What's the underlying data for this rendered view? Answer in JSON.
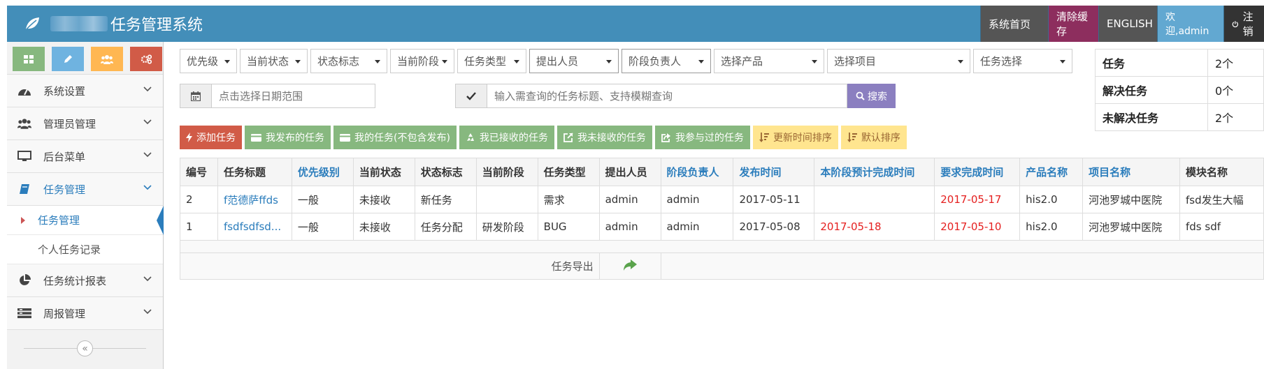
{
  "header": {
    "title": "任务管理系统",
    "nav": [
      "系统首页",
      "清除缓存",
      "ENGLISH",
      "欢迎,admin",
      "注销"
    ],
    "nav_colors": [
      "#555555",
      "#8d2e5e",
      "#555555",
      "#62a8d1",
      "#333333"
    ]
  },
  "sidebar": {
    "shortcut_colors": [
      "#87b87f",
      "#6fb3e0",
      "#ffb752",
      "#d15b47"
    ],
    "shortcut_icons": [
      "grid-icon",
      "pencil-icon",
      "users-icon",
      "cogs-icon"
    ],
    "menu": [
      {
        "label": "系统设置",
        "icon": "dashboard-icon"
      },
      {
        "label": "管理员管理",
        "icon": "users-icon"
      },
      {
        "label": "后台菜单",
        "icon": "monitor-icon"
      },
      {
        "label": "任务管理",
        "icon": "book-icon"
      }
    ],
    "submenu": [
      {
        "label": "任务管理"
      },
      {
        "label": "个人任务记录"
      }
    ],
    "menu2": [
      {
        "label": "任务统计报表",
        "icon": "pie-chart-icon"
      },
      {
        "label": "周报管理",
        "icon": "list-icon"
      }
    ],
    "collapse_glyph": "«"
  },
  "filters": {
    "selects": [
      "优先级",
      "当前状态",
      "状态标志",
      "当前阶段",
      "任务类型",
      "提出人员",
      "阶段负责人",
      "选择产品",
      "选择项目",
      "任务选择"
    ],
    "date_placeholder": "点击选择日期范围",
    "search_placeholder": "输入需查询的任务标题、支持模糊查询",
    "search_label": "搜索"
  },
  "stats": [
    {
      "label": "任务",
      "value": "2个"
    },
    {
      "label": "解决任务",
      "value": "0个"
    },
    {
      "label": "未解决任务",
      "value": "2个"
    }
  ],
  "actions": [
    {
      "label": "添加任务",
      "style": "red"
    },
    {
      "label": "我发布的任务",
      "style": "green"
    },
    {
      "label": "我的任务(不包含发布)",
      "style": "green"
    },
    {
      "label": "我已接收的任务",
      "style": "green"
    },
    {
      "label": "我未接收的任务",
      "style": "green"
    },
    {
      "label": "我参与过的任务",
      "style": "green"
    },
    {
      "label": "更新时间排序",
      "style": "yellow"
    },
    {
      "label": "默认排序",
      "style": "yellow"
    }
  ],
  "table": {
    "columns": [
      "编号",
      "任务标题",
      "优先级别",
      "当前状态",
      "状态标志",
      "当前阶段",
      "任务类型",
      "提出人员",
      "阶段负责人",
      "发布时间",
      "本阶段预计完成时间",
      "要求完成时间",
      "产品名称",
      "项目名称",
      "模块名称"
    ],
    "rows": [
      [
        "2",
        "f范德萨ffds",
        "一般",
        "未接收",
        "新任务",
        "",
        "需求",
        "admin",
        "admin",
        "2017-05-11",
        "",
        "2017-05-17",
        "his2.0",
        "河池罗城中医院",
        "fsd发生大幅"
      ],
      [
        "1",
        "fsdfsdfsd...",
        "一般",
        "未接收",
        "任务分配",
        "研发阶段",
        "BUG",
        "admin",
        "admin",
        "2017-05-08",
        "2017-05-18",
        "2017-05-10",
        "his2.0",
        "河池罗城中医院",
        "fds sdf"
      ]
    ],
    "export_label": "任务导出"
  }
}
